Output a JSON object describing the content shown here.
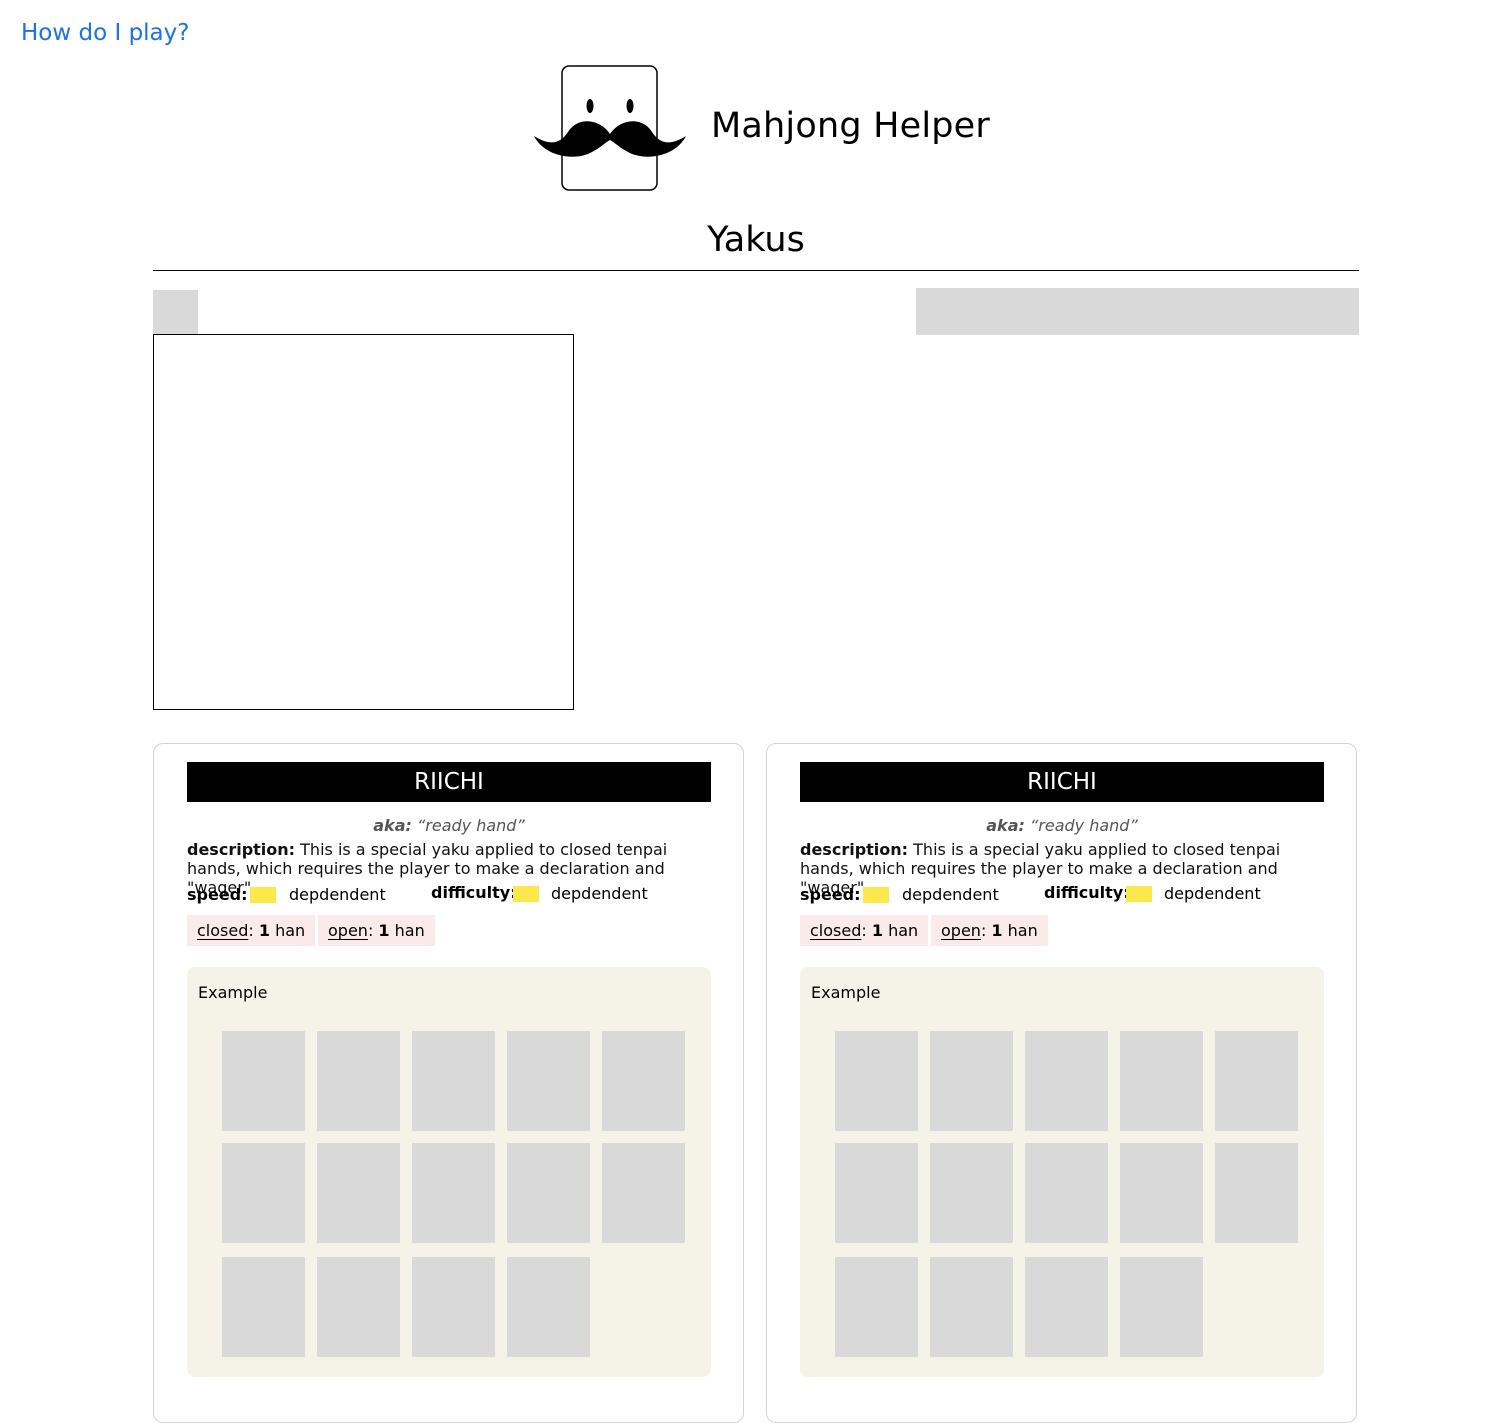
{
  "nav": {
    "help_link": "How do I play?"
  },
  "header": {
    "app_name": "Mahjong Helper",
    "logo_icon": "mustache-tile-logo-icon"
  },
  "page": {
    "title": "Yakus"
  },
  "cards": [
    {
      "name": "RIICHI",
      "aka_label": "aka:",
      "aka_value": "“ready hand”",
      "description_label": "description:",
      "description_text": "This is a special yaku applied to closed tenpai hands, which requires the player to make a declaration and \"wager\".",
      "speed_label": "speed:",
      "speed_value": "depdendent",
      "speed_color": "#fde84b",
      "difficulty_label": "difficulty:",
      "difficulty_value": "depdendent",
      "difficulty_color": "#fde84b",
      "closed_label": "closed",
      "closed_value": "1",
      "closed_unit": "han",
      "open_label": "open",
      "open_value": "1",
      "open_unit": "han",
      "example_label": "Example",
      "tile_count": 14
    },
    {
      "name": "RIICHI",
      "aka_label": "aka:",
      "aka_value": "“ready hand”",
      "description_label": "description:",
      "description_text": "This is a special yaku applied to closed tenpai hands, which requires the player to make a declaration and \"wager\".",
      "speed_label": "speed:",
      "speed_value": "depdendent",
      "speed_color": "#fde84b",
      "difficulty_label": "difficulty:",
      "difficulty_value": "depdendent",
      "difficulty_color": "#fde84b",
      "closed_label": "closed",
      "closed_value": "1",
      "closed_unit": "han",
      "open_label": "open",
      "open_value": "1",
      "open_unit": "han",
      "example_label": "Example",
      "tile_count": 14
    }
  ],
  "colors": {
    "link": "#1a73e8",
    "tag_bg": "#fbeaea",
    "example_bg": "#f5f3e8",
    "placeholder": "#d9d9d9"
  }
}
